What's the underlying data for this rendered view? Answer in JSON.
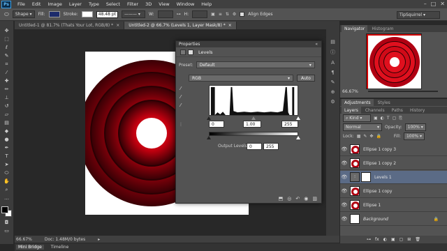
{
  "app": {
    "logo": "Ps"
  },
  "menu": [
    "File",
    "Edit",
    "Image",
    "Layer",
    "Type",
    "Select",
    "Filter",
    "3D",
    "View",
    "Window",
    "Help"
  ],
  "window_controls": [
    "–",
    "□",
    "✕"
  ],
  "options": {
    "tool_mode": "Shape",
    "fill_label": "Fill:",
    "stroke_label": "Stroke:",
    "stroke_width": "48.48 pt",
    "w_label": "W:",
    "h_label": "H:",
    "align_edges": "Align Edges",
    "workspace": "TipSquirrel"
  },
  "tabs": [
    {
      "title": "Untitled-1 @ 81.7% (Thats Your Lot, RGB/8) *",
      "close": "×"
    },
    {
      "title": "Untitled-2 @ 66.7% (Levels 1, Layer Mask/8) *",
      "close": "×"
    }
  ],
  "status": {
    "zoom": "66.67%",
    "doc": "Doc: 1.48M/0 bytes"
  },
  "bottom_tabs": [
    "Mini Bridge",
    "Timeline"
  ],
  "properties": {
    "panel_title": "Properties",
    "adjustment_name": "Levels",
    "preset_label": "Preset:",
    "preset_value": "Default",
    "channel_value": "RGB",
    "auto_label": "Auto",
    "input_black": "0",
    "input_gamma": "1.00",
    "input_white": "255",
    "output_label": "Output Levels:",
    "output_black": "0",
    "output_white": "255",
    "collapse": "«"
  },
  "navigator": {
    "tabs": [
      "Navigator",
      "Histogram"
    ],
    "zoom": "66.67%"
  },
  "adjustments_tabs": [
    "Adjustments",
    "Styles"
  ],
  "layers": {
    "tabs": [
      "Layers",
      "Channels",
      "Paths",
      "History"
    ],
    "kind_label": "Kind",
    "blend_mode": "Normal",
    "opacity_label": "Opacity:",
    "opacity_value": "100%",
    "lock_label": "Lock:",
    "fill_label": "Fill:",
    "fill_value": "100%",
    "items": [
      {
        "name": "Ellipse 1 copy 3",
        "type": "ellipse"
      },
      {
        "name": "Ellipse 1 copy 2",
        "type": "ellipse"
      },
      {
        "name": "Levels 1",
        "type": "levels"
      },
      {
        "name": "Ellipse 1 copy",
        "type": "ellipse"
      },
      {
        "name": "Ellipse 1",
        "type": "ellipse"
      },
      {
        "name": "Background",
        "type": "background"
      }
    ],
    "footer_icons": [
      "fx",
      "◐",
      "▣",
      "▢",
      "⊞",
      "🗑"
    ]
  },
  "colors": {
    "ring_dark": "#3a0005",
    "ring_mid": "#b00012",
    "ring_light": "#ff1a2a",
    "selection": "#5b6b86"
  }
}
